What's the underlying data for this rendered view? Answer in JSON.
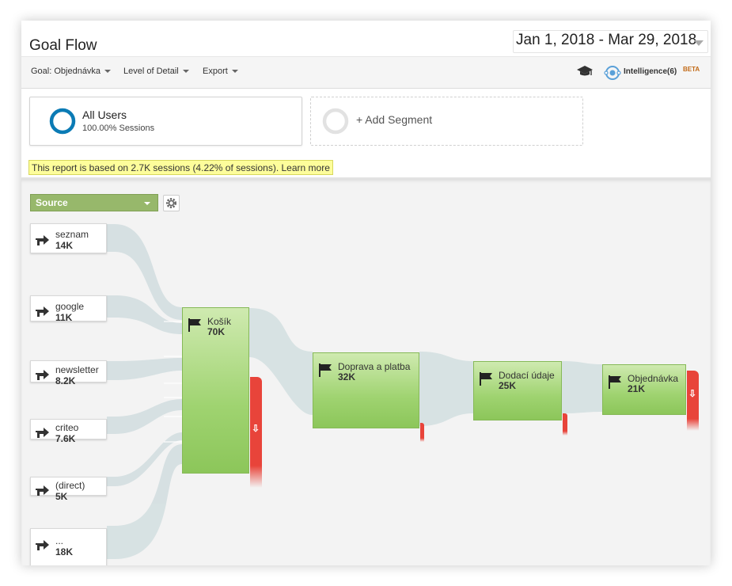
{
  "header": {
    "title": "Goal Flow",
    "date_range": "Jan 1, 2018 - Mar 29, 2018"
  },
  "toolbar": {
    "goal": "Goal: Objednávka",
    "level_of_detail": "Level of Detail",
    "export": "Export",
    "intelligence": "Intelligence(6)",
    "beta": "BETA"
  },
  "segments": {
    "active_title": "All Users",
    "active_sub": "100.00% Sessions",
    "add_label": "+ Add Segment"
  },
  "notice": {
    "text": "This report is based on 2.7K sessions (4.22% of sessions).",
    "link": "Learn more"
  },
  "flow": {
    "dimension": "Source",
    "sources": [
      {
        "name": "seznam",
        "value": "14K"
      },
      {
        "name": "google",
        "value": "11K"
      },
      {
        "name": "newsletter",
        "value": "8.2K"
      },
      {
        "name": "criteo",
        "value": "7.6K"
      },
      {
        "name": "(direct)",
        "value": "5K"
      },
      {
        "name": "...",
        "value": "18K"
      }
    ],
    "steps": [
      {
        "name": "Košík",
        "value": "70K"
      },
      {
        "name": "Doprava a platba",
        "value": "32K"
      },
      {
        "name": "Dodací údaje",
        "value": "25K"
      },
      {
        "name": "Objednávka",
        "value": "21K"
      }
    ]
  },
  "colors": {
    "node_green": "#9fd370",
    "dropoff_red": "#e8443a",
    "flow_band": "#d5e0e2",
    "source_dropdown": "#97b86b",
    "notice_bg": "#fdfd9b"
  },
  "icons": [
    "graduation-cap-icon",
    "intelligence-icon",
    "arrow-right-icon",
    "flag-icon",
    "gear-icon",
    "chevron-down-icon",
    "down-arrow-icon"
  ]
}
